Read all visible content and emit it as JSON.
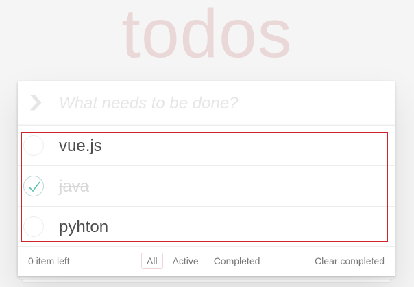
{
  "header": {
    "title": "todos",
    "toggle_all_icon": "chevron-down-icon",
    "new_todo_placeholder": "What needs to be done?"
  },
  "todos": [
    {
      "label": "vue.js",
      "completed": false
    },
    {
      "label": "java",
      "completed": true
    },
    {
      "label": "pyhton",
      "completed": false
    }
  ],
  "footer": {
    "count_text": "0 item left",
    "filters": [
      "All",
      "Active",
      "Completed"
    ],
    "selected_filter": "All",
    "clear_completed": "Clear completed"
  },
  "colors": {
    "title": "#af2f2f",
    "check": "#5dc2af",
    "highlight_border": "#d0242b"
  }
}
